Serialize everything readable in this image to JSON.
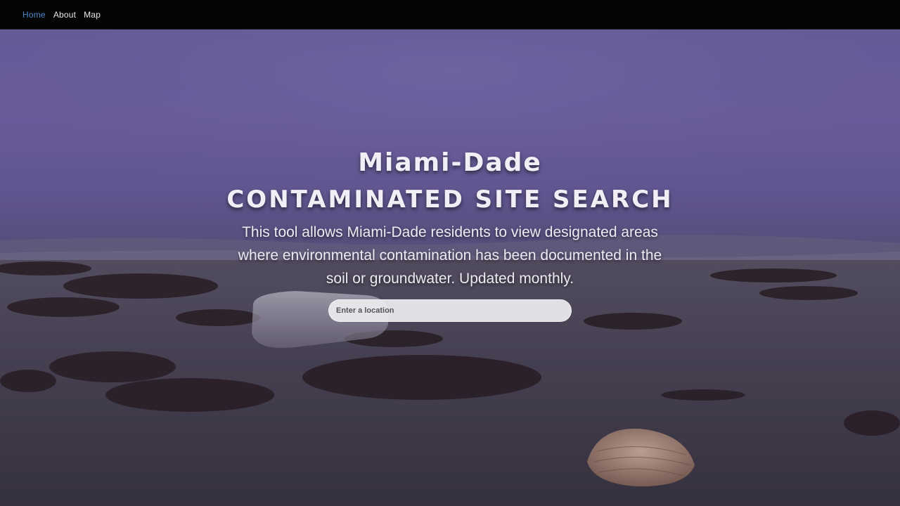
{
  "nav": {
    "items": [
      {
        "label": "Home",
        "active": true
      },
      {
        "label": "About",
        "active": false
      },
      {
        "label": "Map",
        "active": false
      }
    ]
  },
  "hero": {
    "title_line1": "Miami-Dade",
    "title_line2": "CONTAMINATED SITE SEARCH",
    "description": "This tool allows Miami-Dade residents to view designated areas where environmental contamination has been documented in the soil or groundwater. Updated monthly.",
    "background": "beach-with-seaweed-and-plastic-bottle-photo"
  },
  "search": {
    "placeholder": "Enter a location",
    "value": ""
  },
  "colors": {
    "nav_background": "#050505",
    "nav_active": "#4a88c8",
    "nav_text": "#e6e6e6",
    "hero_sky": "#7566a8",
    "title_text": "#f2eef5"
  },
  "icons": {
    "background_image": "beach-photo"
  }
}
